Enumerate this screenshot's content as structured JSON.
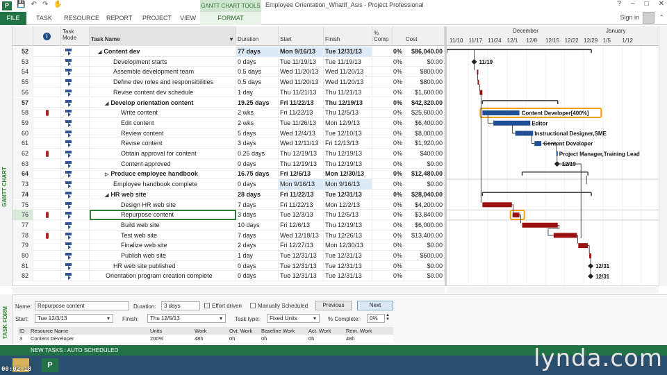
{
  "titlebar": {
    "app_icon": "P",
    "qat_icons": [
      "save-icon",
      "undo-icon",
      "redo-icon",
      "touch-mode-icon"
    ],
    "context_tab_title": "GANTT CHART TOOLS",
    "window_title": "Employee Orientation_WhatIf_Asis - Project Professional",
    "controls": [
      "?",
      "–",
      "□",
      "✕"
    ]
  },
  "ribbon": {
    "tabs": [
      "FILE",
      "TASK",
      "RESOURCE",
      "REPORT",
      "PROJECT",
      "VIEW",
      "FORMAT"
    ],
    "signin": "Sign in"
  },
  "view_label": "GANTT CHART",
  "columns": {
    "mode": "Task Mode",
    "name": "Task Name",
    "duration": "Duration",
    "start": "Start",
    "finish": "Finish",
    "comp": "% Comp",
    "cost": "Cost"
  },
  "timescale": {
    "months": [
      "December",
      "January"
    ],
    "weeks": [
      "11/10",
      "11/17",
      "11/24",
      "12/1",
      "12/8",
      "12/15",
      "12/22",
      "12/29",
      "1/5",
      "1/12"
    ]
  },
  "tasks": [
    {
      "id": "52",
      "name": "Content dev",
      "level": 1,
      "summary": true,
      "expanded": true,
      "duration": "77 days",
      "start": "Mon 9/16/13",
      "finish": "Tue 12/31/13",
      "comp": "0%",
      "cost": "$86,040.00",
      "hl_dur": true
    },
    {
      "id": "53",
      "name": "Development starts",
      "level": 2,
      "duration": "0 days",
      "start": "Tue 11/19/13",
      "finish": "Tue 11/19/13",
      "comp": "0%",
      "cost": "$0.00"
    },
    {
      "id": "54",
      "name": "Assemble development team",
      "level": 2,
      "duration": "0.5 days",
      "start": "Wed 11/20/13",
      "finish": "Wed 11/20/13",
      "comp": "0%",
      "cost": "$800.00"
    },
    {
      "id": "55",
      "name": "Define dev roles and responsibilities",
      "level": 2,
      "duration": "0.5 days",
      "start": "Wed 11/20/13",
      "finish": "Wed 11/20/13",
      "comp": "0%",
      "cost": "$800.00"
    },
    {
      "id": "56",
      "name": "Revise content dev schedule",
      "level": 2,
      "duration": "1 day",
      "start": "Thu 11/21/13",
      "finish": "Thu 11/21/13",
      "comp": "0%",
      "cost": "$1,600.00"
    },
    {
      "id": "57",
      "name": "Develop orientation content",
      "level": 2,
      "summary": true,
      "expanded": true,
      "duration": "19.25 days",
      "start": "Fri 11/22/13",
      "finish": "Thu 12/19/13",
      "comp": "0%",
      "cost": "$42,320.00"
    },
    {
      "id": "58",
      "name": "Write content",
      "level": 3,
      "person": true,
      "duration": "2 wks",
      "start": "Fri 11/22/13",
      "finish": "Thu 12/5/13",
      "comp": "0%",
      "cost": "$25,600.00"
    },
    {
      "id": "59",
      "name": "Edit content",
      "level": 3,
      "duration": "2 wks",
      "start": "Tue 11/26/13",
      "finish": "Mon 12/9/13",
      "comp": "0%",
      "cost": "$6,400.00"
    },
    {
      "id": "60",
      "name": "Review content",
      "level": 3,
      "duration": "5 days",
      "start": "Wed 12/4/13",
      "finish": "Tue 12/10/13",
      "comp": "0%",
      "cost": "$8,000.00"
    },
    {
      "id": "61",
      "name": "Revise content",
      "level": 3,
      "duration": "3 days",
      "start": "Wed 12/11/13",
      "finish": "Fri 12/13/13",
      "comp": "0%",
      "cost": "$1,920.00"
    },
    {
      "id": "62",
      "name": "Obtain approval for content",
      "level": 3,
      "person": true,
      "duration": "0.25 days",
      "start": "Thu 12/19/13",
      "finish": "Thu 12/19/13",
      "comp": "0%",
      "cost": "$400.00"
    },
    {
      "id": "63",
      "name": "Content approved",
      "level": 3,
      "duration": "0 days",
      "start": "Thu 12/19/13",
      "finish": "Thu 12/19/13",
      "comp": "0%",
      "cost": "$0.00"
    },
    {
      "id": "64",
      "name": "Produce employee handbook",
      "level": 2,
      "summary": true,
      "expanded": false,
      "duration": "16.75 days",
      "start": "Fri 12/6/13",
      "finish": "Mon 12/30/13",
      "comp": "0%",
      "cost": "$12,480.00"
    },
    {
      "id": "73",
      "name": "Employee handbook complete",
      "level": 2,
      "duration": "0 days",
      "start": "Mon 9/16/13",
      "finish": "Mon 9/16/13",
      "comp": "0%",
      "cost": "$0.00",
      "hl_dates": true
    },
    {
      "id": "74",
      "name": "HR web site",
      "level": 2,
      "summary": true,
      "expanded": true,
      "duration": "28 days",
      "start": "Fri 11/22/13",
      "finish": "Tue 12/31/13",
      "comp": "0%",
      "cost": "$28,040.00"
    },
    {
      "id": "75",
      "name": "Design HR web site",
      "level": 3,
      "duration": "7 days",
      "start": "Fri 11/22/13",
      "finish": "Mon 12/2/13",
      "comp": "0%",
      "cost": "$4,200.00"
    },
    {
      "id": "76",
      "name": "Repurpose content",
      "level": 3,
      "person": true,
      "selected": true,
      "duration": "3 days",
      "start": "Tue 12/3/13",
      "finish": "Thu 12/5/13",
      "comp": "0%",
      "cost": "$3,840.00"
    },
    {
      "id": "77",
      "name": "Build web site",
      "level": 3,
      "duration": "10 days",
      "start": "Fri 12/6/13",
      "finish": "Thu 12/19/13",
      "comp": "0%",
      "cost": "$6,000.00"
    },
    {
      "id": "78",
      "name": "Test web site",
      "level": 3,
      "person": true,
      "duration": "7 days",
      "start": "Wed 12/18/13",
      "finish": "Thu 12/26/13",
      "comp": "0%",
      "cost": "$13,400.00"
    },
    {
      "id": "79",
      "name": "Finalize web site",
      "level": 3,
      "duration": "2 days",
      "start": "Fri 12/27/13",
      "finish": "Mon 12/30/13",
      "comp": "0%",
      "cost": "$0.00"
    },
    {
      "id": "80",
      "name": "Publish web site",
      "level": 3,
      "duration": "1 day",
      "start": "Tue 12/31/13",
      "finish": "Tue 12/31/13",
      "comp": "0%",
      "cost": "$600.00"
    },
    {
      "id": "81",
      "name": "HR web site published",
      "level": 2,
      "duration": "0 days",
      "start": "Tue 12/31/13",
      "finish": "Tue 12/31/13",
      "comp": "0%",
      "cost": "$0.00"
    },
    {
      "id": "82",
      "name": "Orientation program creation complete",
      "level": 1,
      "duration": "0 days",
      "start": "Tue 12/31/13",
      "finish": "Tue 12/31/13",
      "comp": "0%",
      "cost": "$0.00"
    }
  ],
  "gantt_labels": {
    "ms53": "11/19",
    "write": "Content Developer[400%]",
    "edit": "Editor",
    "review": "Instructional Designer,SME",
    "revise": "Content Developer",
    "approval": "Project Manager,Training Lead",
    "ms63": "12/19",
    "ms81": "12/31",
    "ms82": "12/31"
  },
  "form": {
    "label": "TASK FORM",
    "name_label": "Name:",
    "name_value": "Repurpose content",
    "duration_label": "Duration:",
    "duration_value": "3 days",
    "effort_driven": "Effort driven",
    "manually_scheduled": "Manually Scheduled",
    "previous": "Previous",
    "next": "Next",
    "start_label": "Start:",
    "start_value": "Tue 12/3/13",
    "finish_label": "Finish:",
    "finish_value": "Thu 12/5/13",
    "task_type_label": "Task type:",
    "task_type_value": "Fixed Units",
    "complete_label": "% Complete:",
    "complete_value": "0%",
    "res_headers": [
      "ID",
      "Resource Name",
      "Units",
      "Work",
      "Ovt. Work",
      "Baseline Work",
      "Act. Work",
      "Rem. Work"
    ],
    "res_row": [
      "3",
      "Content Developer",
      "200%",
      "48h",
      "0h",
      "0h",
      "0h",
      "48h"
    ]
  },
  "status": "NEW TASKS : AUTO SCHEDULED",
  "timecode": "00:02:18",
  "watermark": "lynda.com",
  "colors": {
    "accent": "#217346",
    "task_bar": "#1f4e96",
    "critical_bar": "#9b1010",
    "highlight": "#f0a000"
  }
}
